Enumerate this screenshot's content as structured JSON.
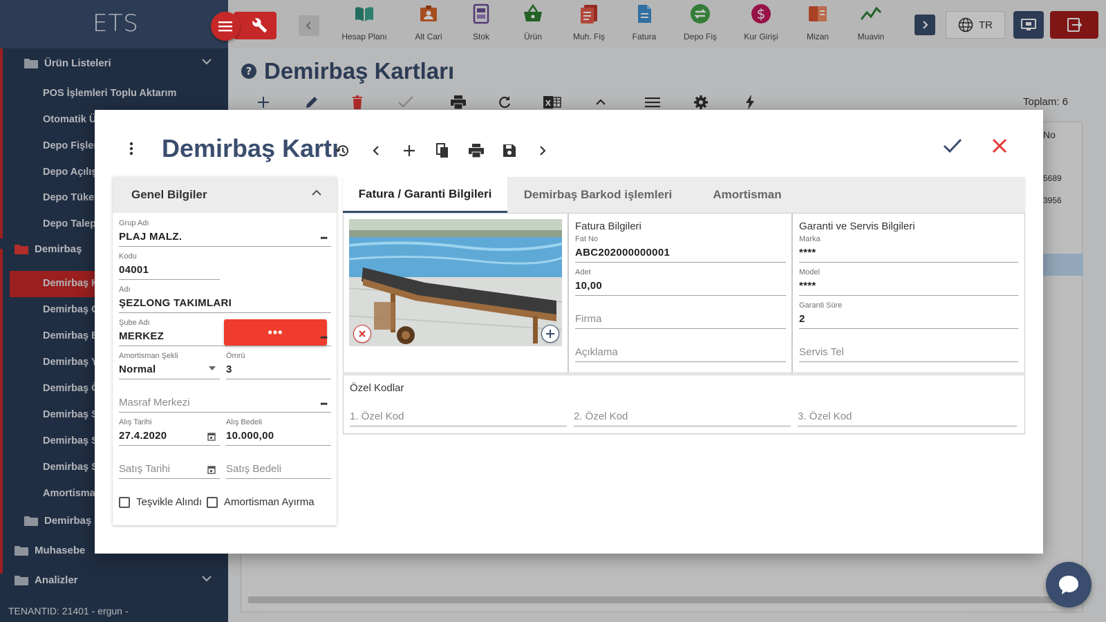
{
  "app": {
    "logo": "ETS"
  },
  "topnav": [
    {
      "label": "Hesap Planı",
      "icon": "book-icon",
      "color": "#2e8b7a"
    },
    {
      "label": "Alt Cari",
      "icon": "contact-card-icon",
      "color": "#d4652a"
    },
    {
      "label": "Stok",
      "icon": "stock-icon",
      "color": "#6a4c93"
    },
    {
      "label": "Ürün",
      "icon": "basket-icon",
      "color": "#2e7d32"
    },
    {
      "label": "Muh. Fiş",
      "icon": "documents-icon",
      "color": "#c0392b"
    },
    {
      "label": "Fatura",
      "icon": "invoice-icon",
      "color": "#3d8fcf"
    },
    {
      "label": "Depo Fiş",
      "icon": "transfer-icon",
      "color": "#43a047"
    },
    {
      "label": "Kur Girişi",
      "icon": "dollar-icon",
      "color": "#c2185b"
    },
    {
      "label": "Mizan",
      "icon": "ledger-icon",
      "color": "#d9542f"
    },
    {
      "label": "Muavin",
      "icon": "trend-icon",
      "color": "#2e7d32"
    }
  ],
  "language": "TR",
  "sidebar": {
    "groups": [
      {
        "label": "Ürün Listeleri"
      },
      {
        "label": "Demirbaş"
      },
      {
        "label": "Demirbaş F"
      },
      {
        "label": "Muhasebe"
      },
      {
        "label": "Analizler"
      }
    ],
    "items": [
      {
        "label": "POS İşlemleri Toplu Aktarım"
      },
      {
        "label": "Otomatik Ü"
      },
      {
        "label": "Depo Fişler"
      },
      {
        "label": "Depo Açılış"
      },
      {
        "label": "Depo Tüket"
      },
      {
        "label": "Depo Talep"
      },
      {
        "label": "Demirbaş K"
      },
      {
        "label": "Demirbaş G"
      },
      {
        "label": "Demirbaş B"
      },
      {
        "label": "Demirbaş Y"
      },
      {
        "label": "Demirbaş Ö"
      },
      {
        "label": "Demirbaş S"
      },
      {
        "label": "Demirbaş S"
      },
      {
        "label": "Demirbaş S"
      },
      {
        "label": "Amortisma"
      }
    ],
    "tenant": "TENANTID: 21401 - ergun -"
  },
  "page": {
    "title": "Demirbaş Kartları",
    "total": "Toplam: 6",
    "grid": {
      "column_header": "No",
      "cells": [
        "5689",
        "3956"
      ]
    }
  },
  "modal": {
    "title": "Demirbaş Kartı",
    "general": {
      "header": "Genel Bilgiler",
      "grup_adi": {
        "label": "Grup Adı",
        "value": "PLAJ MALZ."
      },
      "kodu": {
        "label": "Kodu",
        "value": "04001"
      },
      "adi": {
        "label": "Adı",
        "value": "ŞEZLONG TAKIMLARI"
      },
      "sube_adi": {
        "label": "Şube Adı",
        "value": "MERKEZ"
      },
      "amortisman_sekli": {
        "label": "Amortisman Şekli",
        "value": "Normal"
      },
      "omru": {
        "label": "Ömrü",
        "value": "3"
      },
      "masraf_merkezi": {
        "placeholder": "Masraf Merkezi"
      },
      "alis_tarihi": {
        "label": "Alış Tarihi",
        "value": "27.4.2020"
      },
      "alis_bedeli": {
        "label": "Alış Bedeli",
        "value": "10.000,00"
      },
      "satis_tarihi": {
        "placeholder": "Satış Tarihi"
      },
      "satis_bedeli": {
        "placeholder": "Satış Bedeli"
      },
      "tesvikle_alindi": "Teşvikle Alındı",
      "amortisman_ayirma": "Amortisman Ayırma"
    },
    "tabs": [
      {
        "label": "Fatura / Garanti Bilgileri",
        "active": true
      },
      {
        "label": "Demirbaş Barkod işlemleri",
        "active": false
      },
      {
        "label": "Amortisman",
        "active": false
      }
    ],
    "fatura": {
      "title": "Fatura Bilgileri",
      "fat_no": {
        "label": "Fat No",
        "value": "ABC202000000001"
      },
      "adet": {
        "label": "Adet",
        "value": "10,00"
      },
      "firma": {
        "placeholder": "Firma"
      },
      "aciklama": {
        "placeholder": "Açıklama"
      }
    },
    "garanti": {
      "title": "Garanti ve Servis Bilgileri",
      "marka": {
        "label": "Marka",
        "value": "****"
      },
      "model": {
        "label": "Model",
        "value": "****"
      },
      "garanti_sure": {
        "label": "Garanti Süre",
        "value": "2"
      },
      "servis_tel": {
        "placeholder": "Servis Tel"
      }
    },
    "ozel_kodlar": {
      "title": "Özel Kodlar",
      "kod1": "1. Özel Kod",
      "kod2": "2. Özel Kod",
      "kod3": "3. Özel Kod"
    }
  },
  "colors": {
    "brand": "#3a4d6e",
    "accent_red": "#c62828",
    "sidebar": "#2a3b57"
  }
}
